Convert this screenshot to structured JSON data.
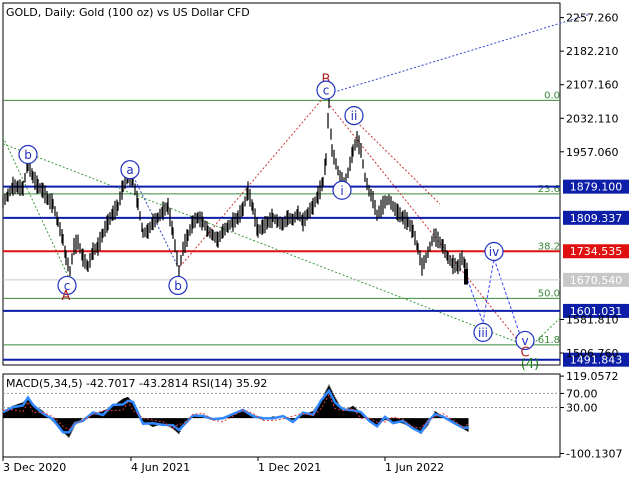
{
  "header": {
    "title": "GOLD, Daily:  Gold (100 oz) vs US Dollar CFD"
  },
  "macd": {
    "label": "MACD(5,34,5) -42.7017 -43.2814 RSI(14) 35.92"
  },
  "colors": {
    "candles": "#000000",
    "blue_level": "#0c1ea8",
    "red_level": "#e01010",
    "fib": "#3a8a3a",
    "wave_blue": "#1f2fbf",
    "wave_red": "#b02020",
    "wave_green": "#1a7a1a",
    "projection_red": "#c82020",
    "projection_blue": "#3344ff",
    "macd_line": "#2f88ff",
    "macd_hist": "#000000"
  },
  "chart_data": {
    "type": "candlestick",
    "title": "GOLD, Daily:  Gold (100 oz) vs US Dollar CFD",
    "x_tick_labels": [
      "3 Dec 2020",
      "4 Jun 2021",
      "1 Dec 2021",
      "1 Jun 2022"
    ],
    "y_tick_labels": [
      "2257.260",
      "2182.210",
      "2107.160",
      "2032.110",
      "1957.060",
      "1581.810",
      "1506.760"
    ],
    "ylim": [
      1480,
      2290
    ],
    "price_series": [
      [
        0,
        1845
      ],
      [
        5,
        1860
      ],
      [
        10,
        1880
      ],
      [
        15,
        1878
      ],
      [
        20,
        1875
      ],
      [
        25,
        1935
      ],
      [
        30,
        1900
      ],
      [
        35,
        1880
      ],
      [
        40,
        1870
      ],
      [
        45,
        1850
      ],
      [
        50,
        1840
      ],
      [
        55,
        1800
      ],
      [
        60,
        1760
      ],
      [
        63,
        1720
      ],
      [
        67,
        1690
      ],
      [
        71,
        1745
      ],
      [
        75,
        1755
      ],
      [
        80,
        1720
      ],
      [
        85,
        1700
      ],
      [
        90,
        1735
      ],
      [
        95,
        1745
      ],
      [
        100,
        1775
      ],
      [
        105,
        1800
      ],
      [
        110,
        1820
      ],
      [
        115,
        1835
      ],
      [
        120,
        1880
      ],
      [
        125,
        1900
      ],
      [
        130,
        1895
      ],
      [
        135,
        1840
      ],
      [
        140,
        1775
      ],
      [
        145,
        1780
      ],
      [
        150,
        1800
      ],
      [
        155,
        1810
      ],
      [
        160,
        1825
      ],
      [
        165,
        1835
      ],
      [
        170,
        1775
      ],
      [
        176,
        1690
      ],
      [
        180,
        1740
      ],
      [
        185,
        1770
      ],
      [
        190,
        1800
      ],
      [
        195,
        1810
      ],
      [
        200,
        1800
      ],
      [
        205,
        1780
      ],
      [
        210,
        1770
      ],
      [
        215,
        1760
      ],
      [
        220,
        1780
      ],
      [
        225,
        1790
      ],
      [
        230,
        1800
      ],
      [
        235,
        1810
      ],
      [
        240,
        1830
      ],
      [
        245,
        1870
      ],
      [
        250,
        1830
      ],
      [
        255,
        1780
      ],
      [
        260,
        1790
      ],
      [
        265,
        1800
      ],
      [
        270,
        1810
      ],
      [
        275,
        1800
      ],
      [
        280,
        1795
      ],
      [
        285,
        1810
      ],
      [
        290,
        1805
      ],
      [
        295,
        1820
      ],
      [
        300,
        1800
      ],
      [
        305,
        1820
      ],
      [
        310,
        1835
      ],
      [
        315,
        1860
      ],
      [
        320,
        1890
      ],
      [
        323,
        1940
      ],
      [
        326,
        2070
      ],
      [
        329,
        1960
      ],
      [
        333,
        1930
      ],
      [
        337,
        1900
      ],
      [
        341,
        1880
      ],
      [
        345,
        1910
      ],
      [
        350,
        1960
      ],
      [
        354,
        1985
      ],
      [
        358,
        1960
      ],
      [
        362,
        1900
      ],
      [
        366,
        1870
      ],
      [
        370,
        1850
      ],
      [
        374,
        1815
      ],
      [
        378,
        1830
      ],
      [
        382,
        1845
      ],
      [
        386,
        1850
      ],
      [
        390,
        1835
      ],
      [
        395,
        1820
      ],
      [
        400,
        1810
      ],
      [
        405,
        1800
      ],
      [
        410,
        1780
      ],
      [
        415,
        1740
      ],
      [
        419,
        1700
      ],
      [
        423,
        1720
      ],
      [
        427,
        1745
      ],
      [
        431,
        1770
      ],
      [
        435,
        1760
      ],
      [
        440,
        1745
      ],
      [
        445,
        1720
      ],
      [
        450,
        1705
      ],
      [
        455,
        1700
      ],
      [
        459,
        1720
      ],
      [
        462,
        1705
      ],
      [
        466,
        1680
      ]
    ],
    "levels": [
      {
        "price": 1879.1,
        "label": "1879.100",
        "color": "#0c1ea8"
      },
      {
        "price": 1809.337,
        "label": "1809.337",
        "color": "#0c1ea8"
      },
      {
        "price": 1734.535,
        "label": "1734.535",
        "color": "#e01010"
      },
      {
        "price": 1601.031,
        "label": "1601.031",
        "color": "#0c1ea8"
      },
      {
        "price": 1491.843,
        "label": "1491.843",
        "color": "#0c1ea8"
      },
      {
        "price": 1670.54,
        "label": "1670.540",
        "color": "#c8c8c8"
      }
    ],
    "fib_levels": [
      {
        "label": "0.0",
        "price": 2072
      },
      {
        "label": "23.6",
        "price": 1863
      },
      {
        "label": "38.2",
        "price": 1734
      },
      {
        "label": "50.0",
        "price": 1629
      },
      {
        "label": "61.8",
        "price": 1525
      }
    ],
    "wave_labels": [
      {
        "text": "b",
        "x": 28,
        "price": 1951,
        "style": "circle",
        "color": "blue"
      },
      {
        "text": "a",
        "x": 130,
        "price": 1917,
        "style": "circle",
        "color": "blue"
      },
      {
        "text": "c",
        "x": 67,
        "price": 1658,
        "style": "circle",
        "color": "blue"
      },
      {
        "text": "A",
        "x": 66,
        "price": 1635,
        "style": "plain",
        "color": "red"
      },
      {
        "text": "b",
        "x": 178,
        "price": 1658,
        "style": "circle",
        "color": "blue"
      },
      {
        "text": "B",
        "x": 326,
        "price": 2120,
        "style": "plain",
        "color": "red"
      },
      {
        "text": "c",
        "x": 326,
        "price": 2095,
        "style": "circle",
        "color": "blue"
      },
      {
        "text": "ii",
        "x": 354,
        "price": 2038,
        "style": "circle",
        "color": "blue"
      },
      {
        "text": "i",
        "x": 342,
        "price": 1871,
        "style": "circle",
        "color": "blue"
      },
      {
        "text": "iii",
        "x": 483,
        "price": 1553,
        "style": "circle",
        "color": "blue"
      },
      {
        "text": "iv",
        "x": 494,
        "price": 1734,
        "style": "circle",
        "color": "blue"
      },
      {
        "text": "v",
        "x": 525,
        "price": 1535,
        "style": "circle",
        "color": "blue"
      },
      {
        "text": "C",
        "x": 525,
        "price": 1509,
        "style": "plain",
        "color": "red"
      },
      {
        "text": "(4)",
        "x": 530,
        "price": 1483,
        "style": "plain",
        "color": "green"
      }
    ],
    "projection_points": [
      [
        466,
        1680
      ],
      [
        483,
        1575
      ],
      [
        494,
        1718
      ],
      [
        525,
        1515
      ]
    ],
    "macd_tick_labels": [
      "119.0572",
      "70.00",
      "30.00",
      "-100.1307"
    ],
    "macd_ylim": [
      -110,
      125
    ],
    "macd_values": [
      [
        0,
        20
      ],
      [
        10,
        35
      ],
      [
        20,
        45
      ],
      [
        25,
        60
      ],
      [
        30,
        40
      ],
      [
        40,
        20
      ],
      [
        50,
        -10
      ],
      [
        60,
        -40
      ],
      [
        66,
        -55
      ],
      [
        72,
        -20
      ],
      [
        80,
        0
      ],
      [
        90,
        10
      ],
      [
        100,
        20
      ],
      [
        110,
        35
      ],
      [
        120,
        55
      ],
      [
        125,
        60
      ],
      [
        130,
        45
      ],
      [
        140,
        -10
      ],
      [
        150,
        -25
      ],
      [
        160,
        -15
      ],
      [
        170,
        -30
      ],
      [
        176,
        -45
      ],
      [
        182,
        -10
      ],
      [
        190,
        5
      ],
      [
        200,
        10
      ],
      [
        210,
        -5
      ],
      [
        220,
        0
      ],
      [
        230,
        15
      ],
      [
        240,
        25
      ],
      [
        250,
        10
      ],
      [
        260,
        -5
      ],
      [
        270,
        5
      ],
      [
        280,
        0
      ],
      [
        290,
        -5
      ],
      [
        300,
        10
      ],
      [
        310,
        20
      ],
      [
        318,
        50
      ],
      [
        326,
        95
      ],
      [
        332,
        60
      ],
      [
        340,
        20
      ],
      [
        350,
        35
      ],
      [
        358,
        15
      ],
      [
        366,
        -10
      ],
      [
        374,
        -20
      ],
      [
        382,
        -5
      ],
      [
        390,
        -10
      ],
      [
        400,
        -15
      ],
      [
        410,
        -30
      ],
      [
        418,
        -45
      ],
      [
        425,
        -20
      ],
      [
        432,
        20
      ],
      [
        440,
        5
      ],
      [
        450,
        -15
      ],
      [
        460,
        -30
      ],
      [
        466,
        -40
      ]
    ]
  }
}
